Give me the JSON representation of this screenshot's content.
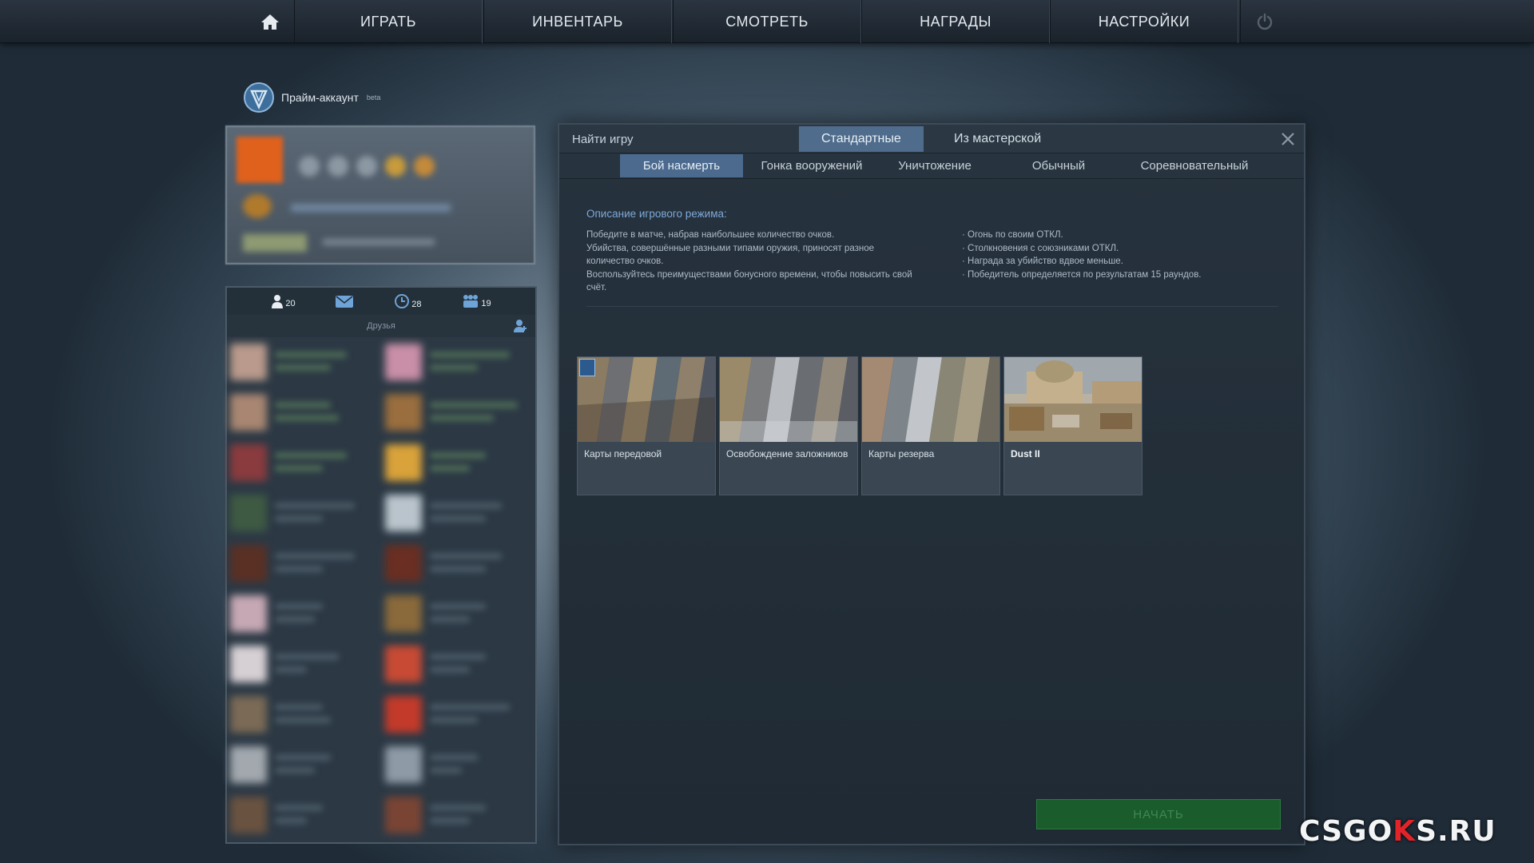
{
  "nav": {
    "items": [
      "ИГРАТЬ",
      "ИНВЕНТАРЬ",
      "СМОТРЕТЬ",
      "НАГРАДЫ",
      "НАСТРОЙКИ"
    ],
    "home_icon": "home-icon",
    "power_icon": "power-icon"
  },
  "prime": {
    "label": "Прайм-аккаунт",
    "beta": "beta"
  },
  "friends": {
    "counts": {
      "friends": "20",
      "history": "28",
      "groups": "19"
    },
    "section_label": "Друзья"
  },
  "dialog": {
    "title": "Найти игру",
    "tabs": [
      "Стандартные",
      "Из мастерской"
    ],
    "active_tab": 0,
    "modes": [
      "Бой насмерть",
      "Гонка вооружений",
      "Уничтожение",
      "Обычный",
      "Соревновательный"
    ],
    "active_mode": 0,
    "description": {
      "title": "Описание игрового режима:",
      "left": [
        "Победите в матче, набрав наибольшее количество очков.",
        "Убийства, совершённые разными типами оружия, приносят разное количество очков.",
        "Воспользуйтесь преимуществами бонусного времени, чтобы повысить свой счёт."
      ],
      "right": [
        "· Огонь по своим ОТКЛ.",
        "· Столкновения с союзниками ОТКЛ.",
        "· Награда за убийство вдвое меньше.",
        "· Победитель определяется по результатам 15 раундов."
      ]
    },
    "maps": [
      {
        "name": "Карты передовой",
        "bold": false
      },
      {
        "name": "Освобождение заложников",
        "bold": false
      },
      {
        "name": "Карты резерва",
        "bold": false
      },
      {
        "name": "Dust II",
        "bold": true
      }
    ],
    "start_label": "НАЧАТЬ"
  },
  "watermark": {
    "part1": "CSGO",
    "part2": "K",
    "part3": "S.RU"
  },
  "colors": {
    "accent_tab": "#4f6c8c",
    "start": "#1b5c2c",
    "desc_title": "#7fa9d8"
  }
}
